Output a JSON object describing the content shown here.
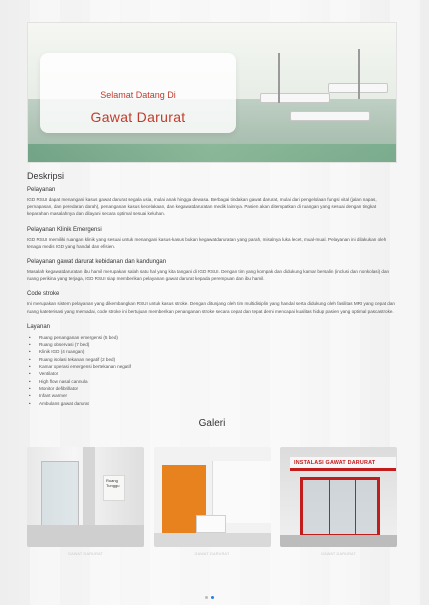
{
  "hero": {
    "welcome": "Selamat Datang Di",
    "title": "Gawat Darurat"
  },
  "description": {
    "heading": "Deskripsi",
    "sections": [
      {
        "title": "Pelayanan",
        "text": "IGD RSUI dapat menangani kasus gawat darurat segala usia, mulai anak hingga dewasa. Berbagai tindakan gawat darurat, mulai dari pengelolaan fungsi vital (jalan napas, pernapasan, dan peredaran darah), penanganan kasus kecelakaan, dan kegawatdaruratan medik lainnya. Pasien akan ditempatkan di ruangan yang sesuai dengan tingkat keparahan masalahnya dan dilayani secara optimal sesuai keluhan."
      },
      {
        "title": "Pelayanan Klinik Emergensi",
        "text": "IGD RSUI memiliki ruangan klinik yang sesuai untuk menangani kasus-kasus bukan kegawatdaruratan yang parah, misalnya luka lecet, mual-mual. Pelayanan ini dilakukan oleh tenaga medis IGD yang handal dan efisien."
      },
      {
        "title": "Pelayanan gawat darurat kebidanan dan kandungan",
        "text": "Masalah kegawatdaruratan ibu hamil merupakan salah satu hal yang kita tangani di IGD RSUI. Dengan tim yang kompak dan didukung kamar bersalin (inclusi dan nonkolasi) dan ruang perikina yang terjaga, IGD RSUI siap memberikan pelayanan gawat darurat kepada perempuan dan ibu hamil."
      },
      {
        "title": "Code stroke",
        "text": "Ini merupakan sistem pelayanan yang dikembangkan RSUI untuk kasus stroke. Dengan ditunjang oleh tim multidisiplin yang handal serta didukung oleh fasilitas MRI yang cepat dan ruang kateterisasi yang memadai, code stroke ini bertujuan memberikan penanganan stroke secara cepat dan tepat demi mencapai kualitas hidup pasien yang optimal pascastroke."
      }
    ],
    "services_title": "Layanan",
    "services": [
      "Ruang penanganan emergensi (5 bed)",
      "Ruang observasi (7 bed)",
      "Klinik IGD (4 ruangan)",
      "Ruang isolasi tekanan negatif (2 bed)",
      "Kamar operasi emergensi bertekanan negatif",
      "Ventilator",
      "High flow nasal cannula",
      "Monitor defibrillator",
      "Infant warmer",
      "Ambulans gawat darurat"
    ]
  },
  "gallery": {
    "title": "Galeri",
    "items": [
      {
        "caption": "GAWAT DARURAT",
        "sign_text": "Ruang Tunggu"
      },
      {
        "caption": "GAWAT DARURAT"
      },
      {
        "caption": "GAWAT DARURAT",
        "banner_text": "INSTALASI GAWAT DARURAT"
      }
    ]
  },
  "colors": {
    "accent": "#c23b2c",
    "active_dot": "#2f7de1"
  }
}
